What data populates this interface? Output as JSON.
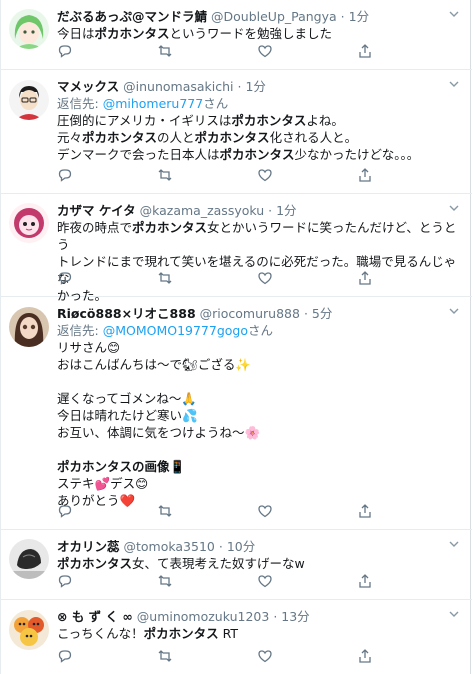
{
  "tweets": [
    {
      "name": "だぶるあっぷ@マンドラ鯖",
      "handle": "@DoubleUp_Pangya",
      "time": "1分",
      "reply_prefix": null,
      "reply_to": null,
      "reply_suffix": null,
      "lines": [
        [
          {
            "t": "今日は"
          },
          {
            "t": "ポカホンタス",
            "b": true
          },
          {
            "t": "というワードを勉強しました"
          }
        ]
      ]
    },
    {
      "name": "マメックス",
      "handle": "@inunomasakichi",
      "time": "1分",
      "reply_prefix": "返信先:",
      "reply_to": "@mihomeru777",
      "reply_suffix": "さん",
      "lines": [
        [
          {
            "t": "圧倒的にアメリカ・イギリスは"
          },
          {
            "t": "ポカホンタス",
            "b": true
          },
          {
            "t": "よね。"
          }
        ],
        [
          {
            "t": "元々"
          },
          {
            "t": "ポカホンタス",
            "b": true
          },
          {
            "t": "の人と"
          },
          {
            "t": "ポカホンタス",
            "b": true
          },
          {
            "t": "化される人と。"
          }
        ],
        [
          {
            "t": "デンマークで会った日本人は"
          },
          {
            "t": "ポカホンタス",
            "b": true
          },
          {
            "t": "少なかったけどな。。。"
          }
        ]
      ]
    },
    {
      "name": "カザマ ケイタ",
      "handle": "@kazama_zassyoku",
      "time": "1分",
      "reply_prefix": null,
      "reply_to": null,
      "reply_suffix": null,
      "lines": [
        [
          {
            "t": "昨夜の時点で"
          },
          {
            "t": "ポカホンタス",
            "b": true
          },
          {
            "t": "女とかいうワードに笑ったんだけど、とうとう"
          }
        ],
        [
          {
            "t": "トレンドにまで現れて笑いを堪えるのに必死だった。職場で見るんじゃな"
          }
        ],
        [
          {
            "t": "かった。"
          }
        ]
      ]
    },
    {
      "name": "Riøcö888×リオこ888",
      "handle": "@riocomuru888",
      "time": "5分",
      "reply_prefix": "返信先:",
      "reply_to": "@MOMOMO19777gogo",
      "reply_suffix": "さん",
      "lines": [
        [
          {
            "t": "リサさん😊"
          }
        ],
        [
          {
            "t": "おはこんばんちは～で🐿ござる✨"
          }
        ],
        [
          {
            "t": " "
          }
        ],
        [
          {
            "t": "遅くなってゴメンね～🙏"
          }
        ],
        [
          {
            "t": "今日は晴れたけど寒い💦"
          }
        ],
        [
          {
            "t": "お互い、体調に気をつけようね～🌸"
          }
        ],
        [
          {
            "t": " "
          }
        ],
        [
          {
            "t": "ポカホンタスの画像",
            "b": true
          },
          {
            "t": "📱"
          }
        ],
        [
          {
            "t": "ステキ💕デス😊"
          }
        ],
        [
          {
            "t": "ありがとう❤️"
          }
        ]
      ]
    },
    {
      "name": "オカリン蕊",
      "handle": "@tomoka3510",
      "time": "10分",
      "reply_prefix": null,
      "reply_to": null,
      "reply_suffix": null,
      "lines": [
        [
          {
            "t": "ポカホンタス",
            "b": true
          },
          {
            "t": "女、て表現考えた奴すげーなw"
          }
        ]
      ]
    },
    {
      "name": "⊗ も ず く ∞",
      "handle": "@uminomozuku1203",
      "time": "13分",
      "reply_prefix": null,
      "reply_to": null,
      "reply_suffix": null,
      "lines": [
        [
          {
            "t": "こっちくんな！"
          },
          {
            "t": "ポカホンタス",
            "b": true
          },
          {
            "t": " RT"
          }
        ]
      ]
    }
  ],
  "colors": {
    "link": "#1da1f2",
    "muted": "#657786",
    "text": "#14171a",
    "divider": "#e6ecf0"
  },
  "icons": [
    "reply-icon",
    "retweet-icon",
    "like-icon",
    "share-icon",
    "chevron-down-icon"
  ]
}
